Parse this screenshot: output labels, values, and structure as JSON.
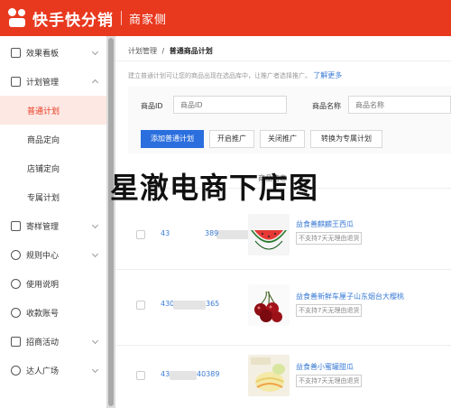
{
  "header": {
    "brand": "快手快分销",
    "sub": "商家侧"
  },
  "sidebar": {
    "items": [
      {
        "label": "效果看板"
      },
      {
        "label": "计划管理"
      },
      {
        "label": "寄样管理"
      },
      {
        "label": "规则中心"
      },
      {
        "label": "使用说明"
      },
      {
        "label": "收款账号"
      },
      {
        "label": "招商活动"
      },
      {
        "label": "达人广场"
      }
    ],
    "sub_items": [
      {
        "label": "普通计划"
      },
      {
        "label": "商品定向"
      },
      {
        "label": "店铺定向"
      },
      {
        "label": "专属计划"
      }
    ]
  },
  "breadcrumb": {
    "parent": "计划管理",
    "sep": "/",
    "current": "普通商品计划"
  },
  "tip": {
    "text": "建立普通计划可让您的商品出现在选品库中，让推广者选择推广。",
    "link": "了解更多"
  },
  "filters": {
    "product_id_label": "商品ID",
    "product_id_placeholder": "商品ID",
    "product_name_label": "商品名称",
    "product_name_placeholder": "商品名称"
  },
  "actions": {
    "add": "添加普通计划",
    "open": "开启推广",
    "close": "关闭推广",
    "convert": "转换为专属计划"
  },
  "watermark": "星澈电商下店图",
  "table": {
    "product_col": "商品信息"
  },
  "rows": [
    {
      "id_prefix": "43",
      "id_suffix": "389",
      "name": "益食善麒麟王西瓜",
      "tag": "不支持7天无理由退货",
      "thumb": "watermelon"
    },
    {
      "id_prefix": "430",
      "id_suffix": "365",
      "name": "益食善新鲜车厘子山东烟台大樱桃",
      "tag": "不支持7天无理由退货",
      "thumb": "cherries"
    },
    {
      "id_prefix": "43",
      "id_suffix": "40389",
      "name": "益食善小蜜罐甜瓜",
      "tag": "不支持7天无理由退货",
      "thumb": "melon"
    }
  ],
  "colors": {
    "brand": "#e8391f",
    "primary": "#2b6fde",
    "link": "#3a7bd5"
  }
}
